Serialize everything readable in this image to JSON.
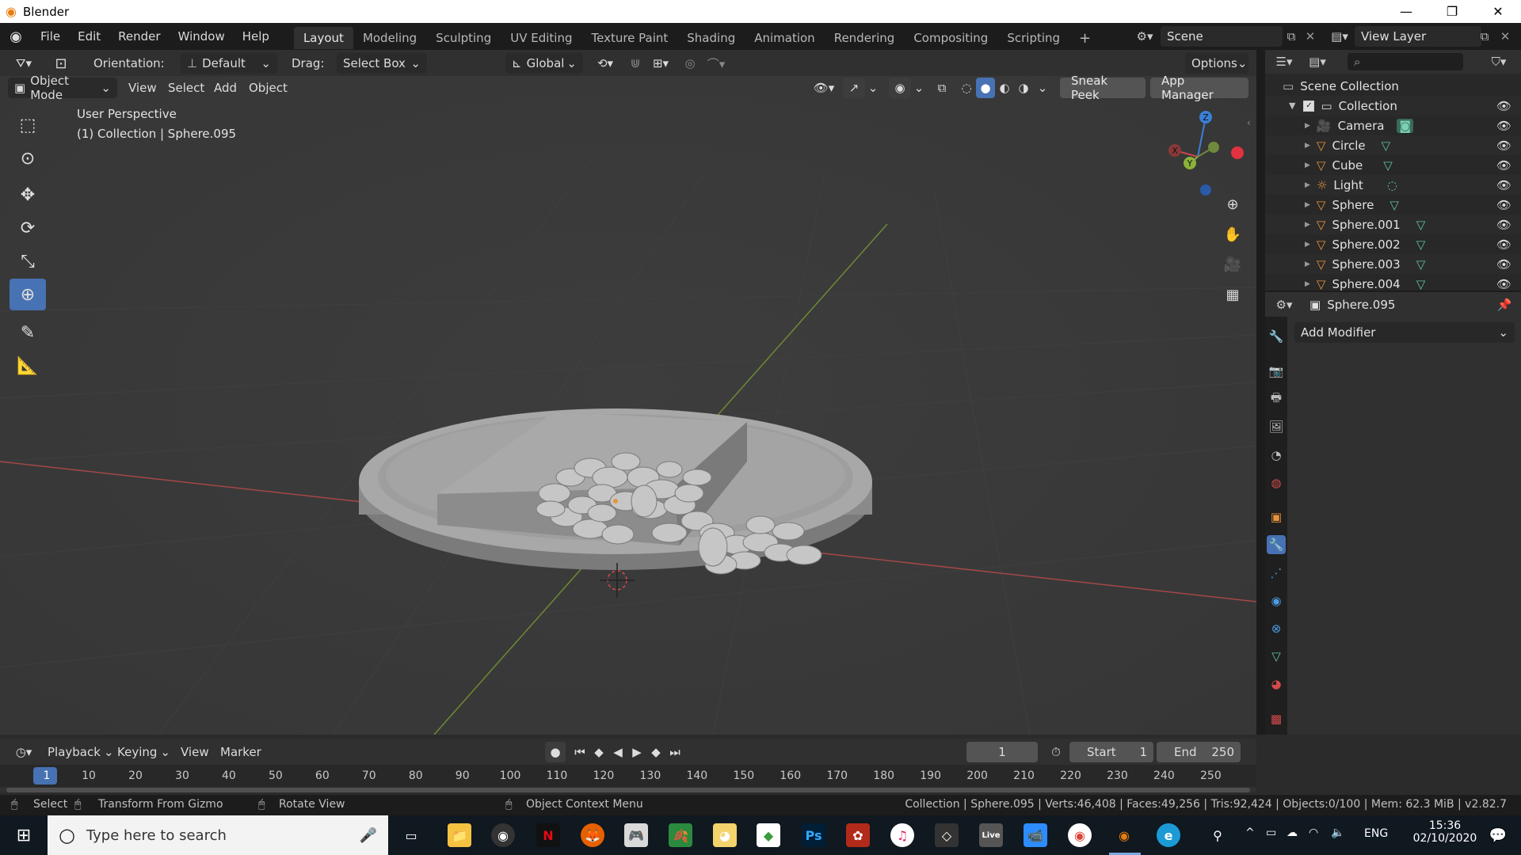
{
  "window": {
    "title": "Blender",
    "minimize": "—",
    "maximize": "❐",
    "close": "✕"
  },
  "menu": [
    "File",
    "Edit",
    "Render",
    "Window",
    "Help"
  ],
  "workspaces": [
    "Layout",
    "Modeling",
    "Sculpting",
    "UV Editing",
    "Texture Paint",
    "Shading",
    "Animation",
    "Rendering",
    "Compositing",
    "Scripting"
  ],
  "workspace_add": "+",
  "scene": {
    "name": "Scene",
    "view_layer": "View Layer"
  },
  "header": {
    "orientation_label": "Orientation:",
    "orientation_value": "Default",
    "drag_label": "Drag:",
    "drag_value": "Select Box",
    "transform_orientation": "Global",
    "options": "Options"
  },
  "header2": {
    "mode": "Object Mode",
    "view": "View",
    "select": "Select",
    "add": "Add",
    "object": "Object",
    "sneak_peek": "Sneak Peek",
    "app_manager": "App Manager"
  },
  "viewport": {
    "perspective": "User Perspective",
    "collection_info": "(1) Collection | Sphere.095",
    "gizmo": {
      "x": "X",
      "y": "Y",
      "z": "Z"
    }
  },
  "outliner": {
    "root": "Scene Collection",
    "collection": "Collection",
    "items": [
      "Camera",
      "Circle",
      "Cube",
      "Light",
      "Sphere",
      "Sphere.001",
      "Sphere.002",
      "Sphere.003",
      "Sphere.004"
    ]
  },
  "properties": {
    "object_name": "Sphere.095",
    "add_modifier": "Add Modifier"
  },
  "timeline": {
    "playback": "Playback",
    "keying": "Keying",
    "view": "View",
    "marker": "Marker",
    "current_frame": "1",
    "start_label": "Start",
    "start_value": "1",
    "end_label": "End",
    "end_value": "250",
    "ticks": [
      "1",
      "10",
      "20",
      "30",
      "40",
      "50",
      "60",
      "70",
      "80",
      "90",
      "100",
      "110",
      "120",
      "130",
      "140",
      "150",
      "160",
      "170",
      "180",
      "190",
      "200",
      "210",
      "220",
      "230",
      "240",
      "250"
    ]
  },
  "status": {
    "select": "Select",
    "transform": "Transform From Gizmo",
    "rotate": "Rotate View",
    "context_menu": "Object Context Menu",
    "stats": "Collection | Sphere.095 | Verts:46,408 | Faces:49,256 | Tris:92,424 | Objects:0/100 | Mem: 62.3 MiB | v2.82.7"
  },
  "taskbar": {
    "search_placeholder": "Type here to search",
    "lang": "ENG",
    "time": "15:36",
    "date": "02/10/2020",
    "icons": [
      "Ps",
      "Live"
    ]
  },
  "colors": {
    "accent": "#4772b3",
    "x_axis": "#c84b4b",
    "y_axis": "#8bb23a",
    "z_axis": "#3b7fd6",
    "object_orange": "#e8943a",
    "mesh_green": "#5fc49a"
  }
}
